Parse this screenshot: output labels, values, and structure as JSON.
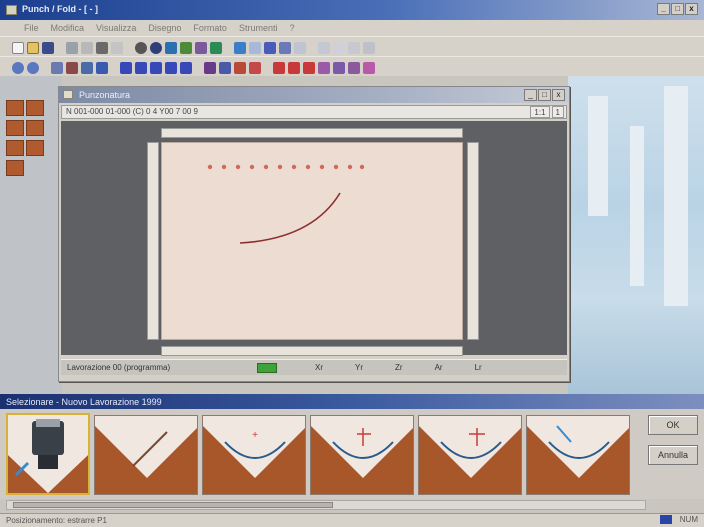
{
  "window": {
    "title": "Punch / Fold - [ - ]",
    "controls": [
      "_",
      "□",
      "x"
    ]
  },
  "menu": [
    "File",
    "Modifica",
    "Visualizza",
    "Disegno",
    "Formato",
    "Strumenti",
    "?"
  ],
  "toolbar_icons_row1": [
    "new-icon",
    "open-icon",
    "save-icon",
    "print-icon",
    "cut-icon",
    "copy-icon",
    "paste-icon",
    "undo-icon",
    "redo-icon",
    "zoom-icon",
    "grid-icon",
    "layer-icon",
    "settings-icon",
    "help-icon"
  ],
  "toolbar_icons_row2": [
    "zoom-in-icon",
    "zoom-out-icon",
    "fit-icon",
    "select-icon",
    "move-icon",
    "rotate-icon",
    "mirror-icon",
    "measure-icon",
    "text-icon",
    "arrow-icon",
    "bend-icon",
    "tool-icon",
    "node-icon"
  ],
  "child_window": {
    "title": "Punzonatura",
    "info": "N 001-000 01-000 (C) 0 4 Y00 7 00 9",
    "zoom": "1:1",
    "page": "1",
    "status_text": "Lavorazione 00 (programma)",
    "axes": [
      "Xr",
      "Yr",
      "Zr",
      "Ar",
      "Lr"
    ]
  },
  "dock": {
    "title": "Selezionare - Nuovo Lavorazione 1999",
    "tools": [
      "tool-holder",
      "line",
      "arc-up",
      "arc-offset",
      "arc-radius",
      "arc-angle"
    ],
    "ok_label": "OK",
    "cancel_label": "Annulla"
  },
  "statusbar": {
    "left": "Posizionamento: estrarre P1",
    "right": "NUM"
  },
  "colors": {
    "title_active": "#1b3f8e",
    "sheet": "#ecdcd2",
    "arc": "#8b2f2f",
    "tile_copper": "#a8572a",
    "green_indicator": "#3fa33a"
  }
}
